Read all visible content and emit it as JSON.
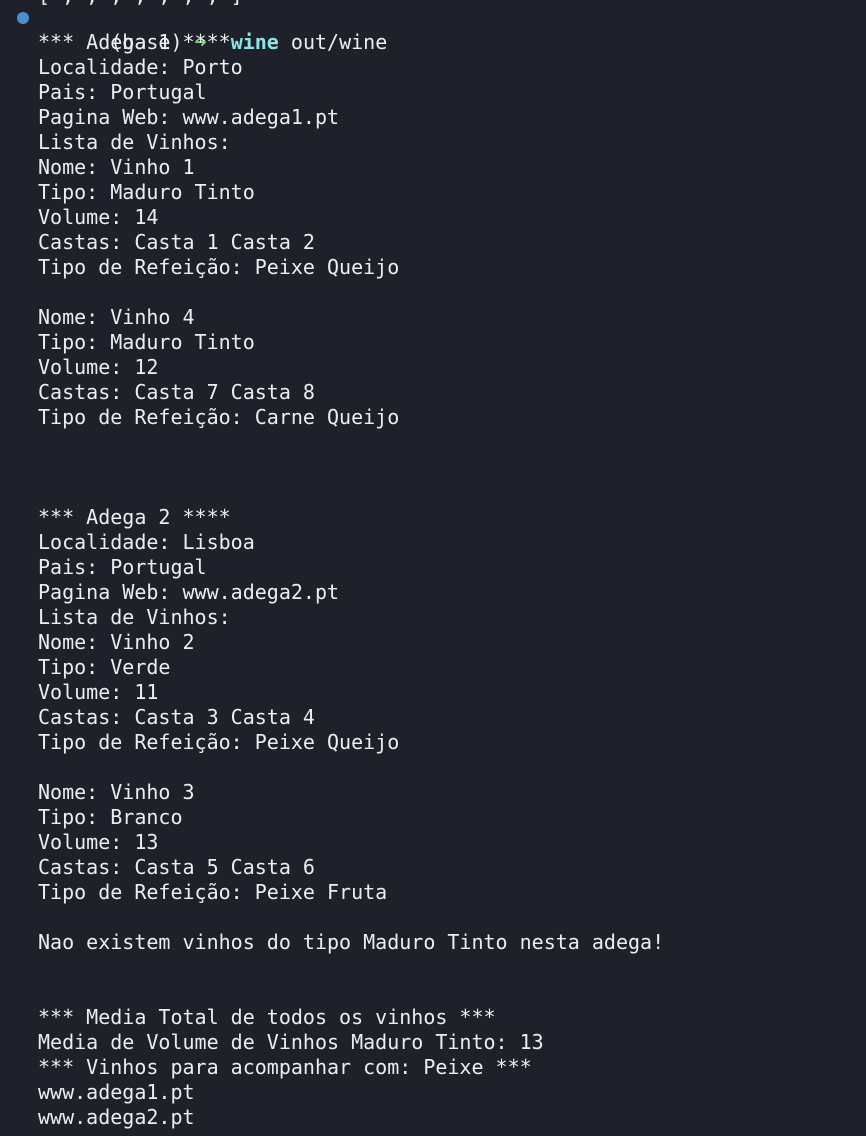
{
  "colors": {
    "background": "#1f212a",
    "foreground": "#ecedf1",
    "prompt_arrow": "#7ee27e",
    "command": "#8fe3e6",
    "marker": "#4b8fd0"
  },
  "icons": {
    "prompt_marker": "dot-marker",
    "cursor": "block-cursor"
  },
  "prompt": {
    "env": "(base)",
    "arrow": "➜",
    "command": "wine",
    "args": "out/wine"
  },
  "output": [
    "*** Adega 1 ****",
    "Localidade: Porto",
    "Pais: Portugal",
    "Pagina Web: www.adega1.pt",
    "Lista de Vinhos:",
    "Nome: Vinho 1",
    "Tipo: Maduro Tinto",
    "Volume: 14",
    "Castas: Casta 1 Casta 2",
    "Tipo de Refeição: Peixe Queijo",
    "",
    "Nome: Vinho 4",
    "Tipo: Maduro Tinto",
    "Volume: 12",
    "Castas: Casta 7 Casta 8",
    "Tipo de Refeição: Carne Queijo",
    "",
    "",
    "",
    "*** Adega 2 ****",
    "Localidade: Lisboa",
    "Pais: Portugal",
    "Pagina Web: www.adega2.pt",
    "Lista de Vinhos:",
    "Nome: Vinho 2",
    "Tipo: Verde",
    "Volume: 11",
    "Castas: Casta 3 Casta 4",
    "Tipo de Refeição: Peixe Queijo",
    "",
    "Nome: Vinho 3",
    "Tipo: Branco",
    "Volume: 13",
    "Castas: Casta 5 Casta 6",
    "Tipo de Refeição: Peixe Fruta",
    "",
    "Nao existem vinhos do tipo Maduro Tinto nesta adega!",
    "",
    "",
    "*** Media Total de todos os vinhos ***",
    "Media de Volume de Vinhos Maduro Tinto: 13",
    "*** Vinhos para acompanhar com: Peixe ***",
    "www.adega1.pt",
    "www.adega2.pt"
  ]
}
